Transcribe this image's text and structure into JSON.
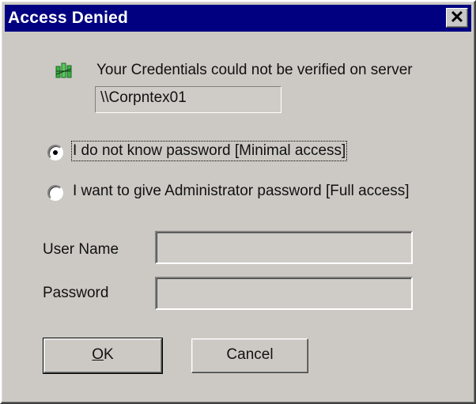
{
  "dialog": {
    "title": "Access Denied",
    "close_glyph": "✕",
    "icon": "network-servers-icon",
    "message": "Your Credentials could not be verified on server",
    "server_name": "\\\\Corpntex01"
  },
  "options": [
    {
      "label": "I do not know password  [Minimal access]",
      "selected": true
    },
    {
      "label": "I want to give Administrator password  [Full access]",
      "selected": false
    }
  ],
  "fields": {
    "username_label": "User Name",
    "username_value": "",
    "password_label": "Password",
    "password_value": ""
  },
  "buttons": {
    "ok_mnemonic": "O",
    "ok_rest": "K",
    "cancel": "Cancel"
  },
  "colors": {
    "titlebar": "#000080",
    "dialog_bg": "#ccc9c4",
    "icon": "#3cb043"
  }
}
